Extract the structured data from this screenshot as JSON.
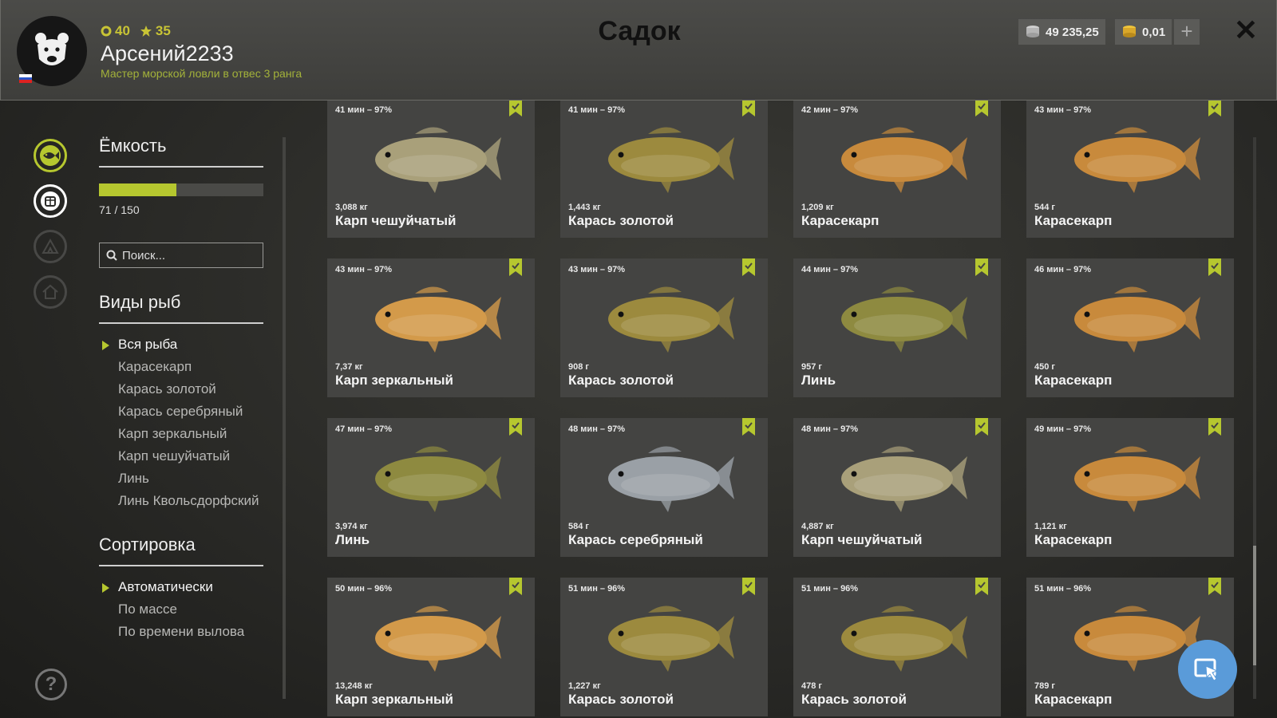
{
  "player": {
    "level": "40",
    "stars": "35",
    "name": "Арсений2233",
    "rank": "Мастер морской ловли в отвес 3 ранга"
  },
  "window": {
    "title": "Садок"
  },
  "currency": {
    "silver": "49 235,25",
    "gold": "0,01"
  },
  "sidebar": {
    "capacity_title": "Ёмкость",
    "capacity_text": "71 / 150",
    "capacity_fraction": 0.473,
    "search_placeholder": "Поиск...",
    "species_title": "Виды рыб",
    "species": [
      "Вся рыба",
      "Карасекарп",
      "Карась золотой",
      "Карась серебряный",
      "Карп зеркальный",
      "Карп чешуйчатый",
      "Линь",
      "Линь Квольсдорфский"
    ],
    "species_selected": 0,
    "sort_title": "Сортировка",
    "sort": [
      "Автоматически",
      "По массе",
      "По времени вылова"
    ],
    "sort_selected": 0
  },
  "fish_cards": [
    {
      "time": "41 мин – 97%",
      "weight": "3,088 кг",
      "name": "Карп чешуйчатый",
      "color": "#a9a07a"
    },
    {
      "time": "41 мин – 97%",
      "weight": "1,443 кг",
      "name": "Карась золотой",
      "color": "#9c8a3e"
    },
    {
      "time": "42 мин – 97%",
      "weight": "1,209 кг",
      "name": "Карасекарп",
      "color": "#c88a3c"
    },
    {
      "time": "43 мин – 97%",
      "weight": "544 г",
      "name": "Карасекарп",
      "color": "#c88a3c"
    },
    {
      "time": "43 мин – 97%",
      "weight": "7,37 кг",
      "name": "Карп зеркальный",
      "color": "#d39a4a"
    },
    {
      "time": "43 мин – 97%",
      "weight": "908 г",
      "name": "Карась золотой",
      "color": "#9c8a3e"
    },
    {
      "time": "44 мин – 97%",
      "weight": "957 г",
      "name": "Линь",
      "color": "#8e8a40"
    },
    {
      "time": "46 мин – 97%",
      "weight": "450 г",
      "name": "Карасекарп",
      "color": "#c88a3c"
    },
    {
      "time": "47 мин – 97%",
      "weight": "3,974 кг",
      "name": "Линь",
      "color": "#8e8a40"
    },
    {
      "time": "48 мин – 97%",
      "weight": "584 г",
      "name": "Карась серебряный",
      "color": "#9aa0a6"
    },
    {
      "time": "48 мин – 97%",
      "weight": "4,887 кг",
      "name": "Карп чешуйчатый",
      "color": "#a9a07a"
    },
    {
      "time": "49 мин – 97%",
      "weight": "1,121 кг",
      "name": "Карасекарп",
      "color": "#c88a3c"
    },
    {
      "time": "50 мин – 96%",
      "weight": "13,248 кг",
      "name": "Карп зеркальный",
      "color": "#d39a4a"
    },
    {
      "time": "51 мин – 96%",
      "weight": "1,227 кг",
      "name": "Карась золотой",
      "color": "#9c8a3e"
    },
    {
      "time": "51 мин – 96%",
      "weight": "478 г",
      "name": "Карась золотой",
      "color": "#9c8a3e"
    },
    {
      "time": "51 мин – 96%",
      "weight": "789 г",
      "name": "Карасекарп",
      "color": "#c88a3c"
    }
  ],
  "colors": {
    "accent": "#b6c72f",
    "fab": "#5a9bd9"
  }
}
